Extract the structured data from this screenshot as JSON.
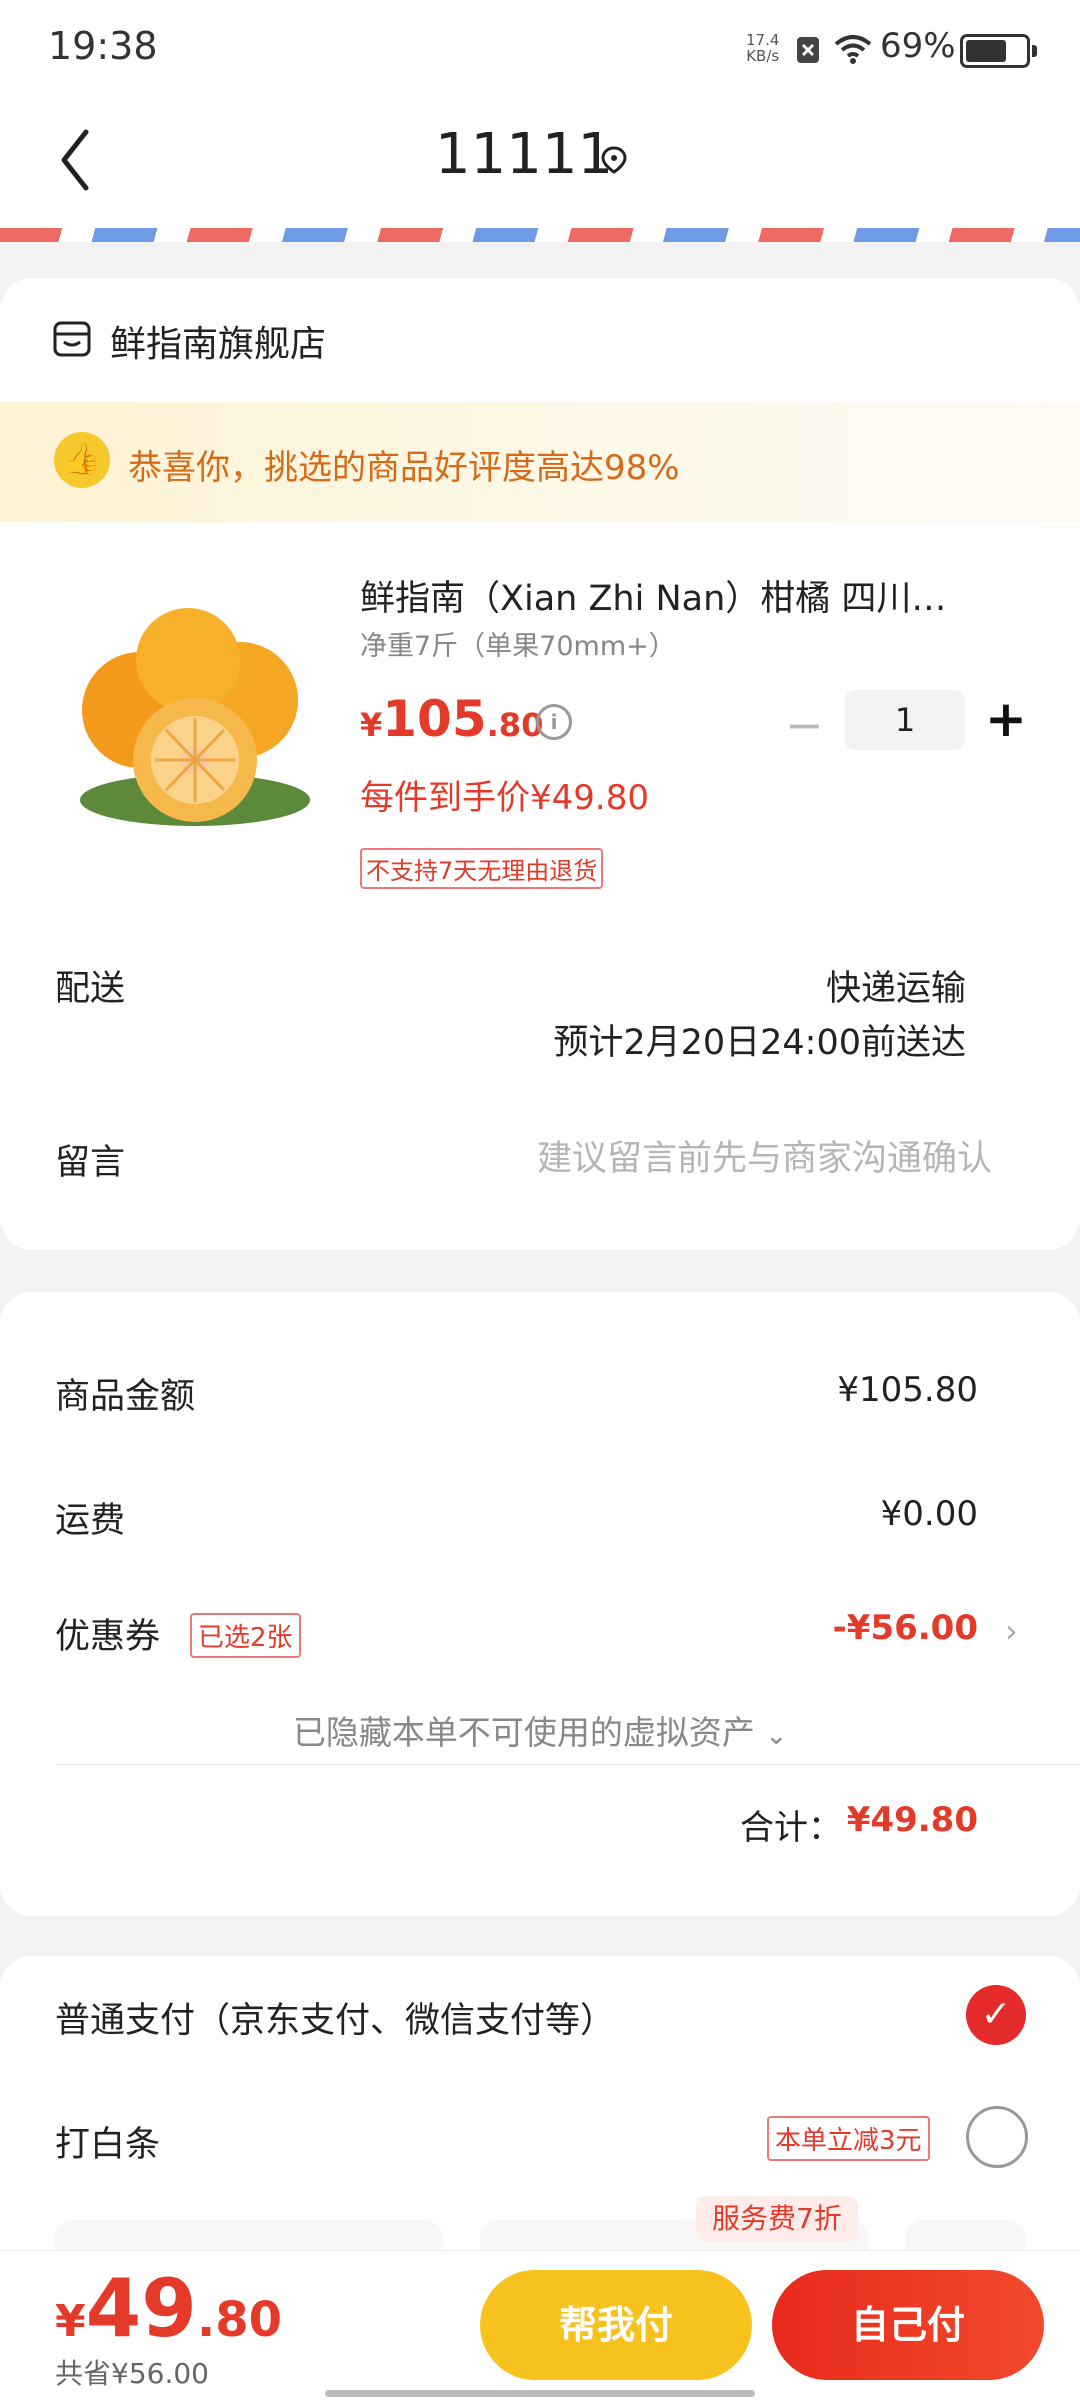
{
  "status_bar": {
    "time": "19:38",
    "net_speed": "17.4",
    "net_unit": "KB/s",
    "battery": "69%"
  },
  "header": {
    "address": "11111"
  },
  "shop": {
    "name": "鲜指南旗舰店",
    "banner": "恭喜你，挑选的商品好评度高达98%"
  },
  "product": {
    "title": "鲜指南（Xian Zhi Nan）柑橘 四川…",
    "spec": "净重7斤（单果70mm+）",
    "price_symbol": "¥",
    "price_int": "105",
    "price_dec": ".80",
    "hand_price": "每件到手价¥49.80",
    "return_note": "不支持7天无理由退货",
    "quantity": "1",
    "minus": "−",
    "plus": "+"
  },
  "delivery": {
    "label": "配送",
    "type": "快递运输",
    "eta": "预计2月20日24:00前送达"
  },
  "message": {
    "label": "留言",
    "placeholder": "建议留言前先与商家沟通确认"
  },
  "summary": {
    "goods_label": "商品金额",
    "goods_value": "¥105.80",
    "shipping_label": "运费",
    "shipping_value": "¥0.00",
    "coupon_label": "优惠券",
    "coupon_badge": "已选2张",
    "coupon_value": "-¥56.00",
    "hidden_note": "已隐藏本单不可使用的虚拟资产",
    "total_label": "合计：",
    "total_value": "¥49.80"
  },
  "payment": {
    "option1": "普通支付（京东支付、微信支付等）",
    "option2": "打白条",
    "option2_badge": "本单立减3元",
    "fee_badge": "服务费7折"
  },
  "bottom_bar": {
    "price_symbol": "¥",
    "price_int": "49",
    "price_dec": ".80",
    "saved": "共省¥56.00",
    "help_pay": "帮我付",
    "self_pay": "自己付"
  },
  "colors": {
    "accent": "#e33a2a",
    "help_button": "#f8c21e",
    "banner_text": "#d66a17"
  }
}
